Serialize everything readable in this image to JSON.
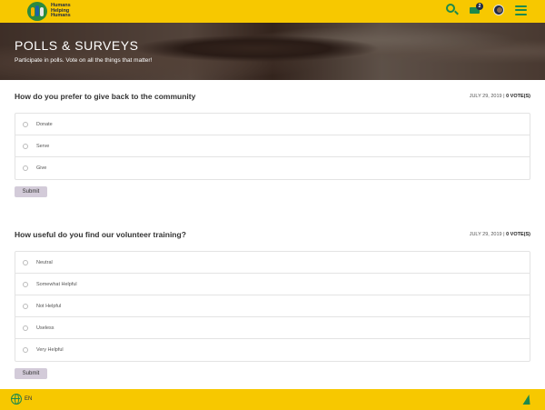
{
  "header": {
    "logo_lines": [
      "Humans",
      "Helping",
      "Humans"
    ],
    "message_badge": "2"
  },
  "hero": {
    "title": "POLLS & SURVEYS",
    "subtitle": "Participate in polls. Vote on all the things that matter!"
  },
  "polls": [
    {
      "question": "How do you prefer to give back to the community",
      "date": "JULY 29, 2019",
      "separator": " | ",
      "votes": "0 VOTE(S)",
      "options": [
        "Donate",
        "Serve",
        "Give"
      ],
      "submit_label": "Submit"
    },
    {
      "question": "How useful do you find our volunteer training?",
      "date": "JULY 29, 2019",
      "separator": " | ",
      "votes": "0 VOTE(S)",
      "options": [
        "Neutral",
        "Somewhat Helpful",
        "Not Helpful",
        "Useless",
        "Very Helpful"
      ],
      "submit_label": "Submit"
    }
  ],
  "footer": {
    "language": "EN"
  },
  "colors": {
    "brand_yellow": "#f7c800",
    "brand_green": "#1e8a4c",
    "submit_bg": "#d3cbd9"
  }
}
